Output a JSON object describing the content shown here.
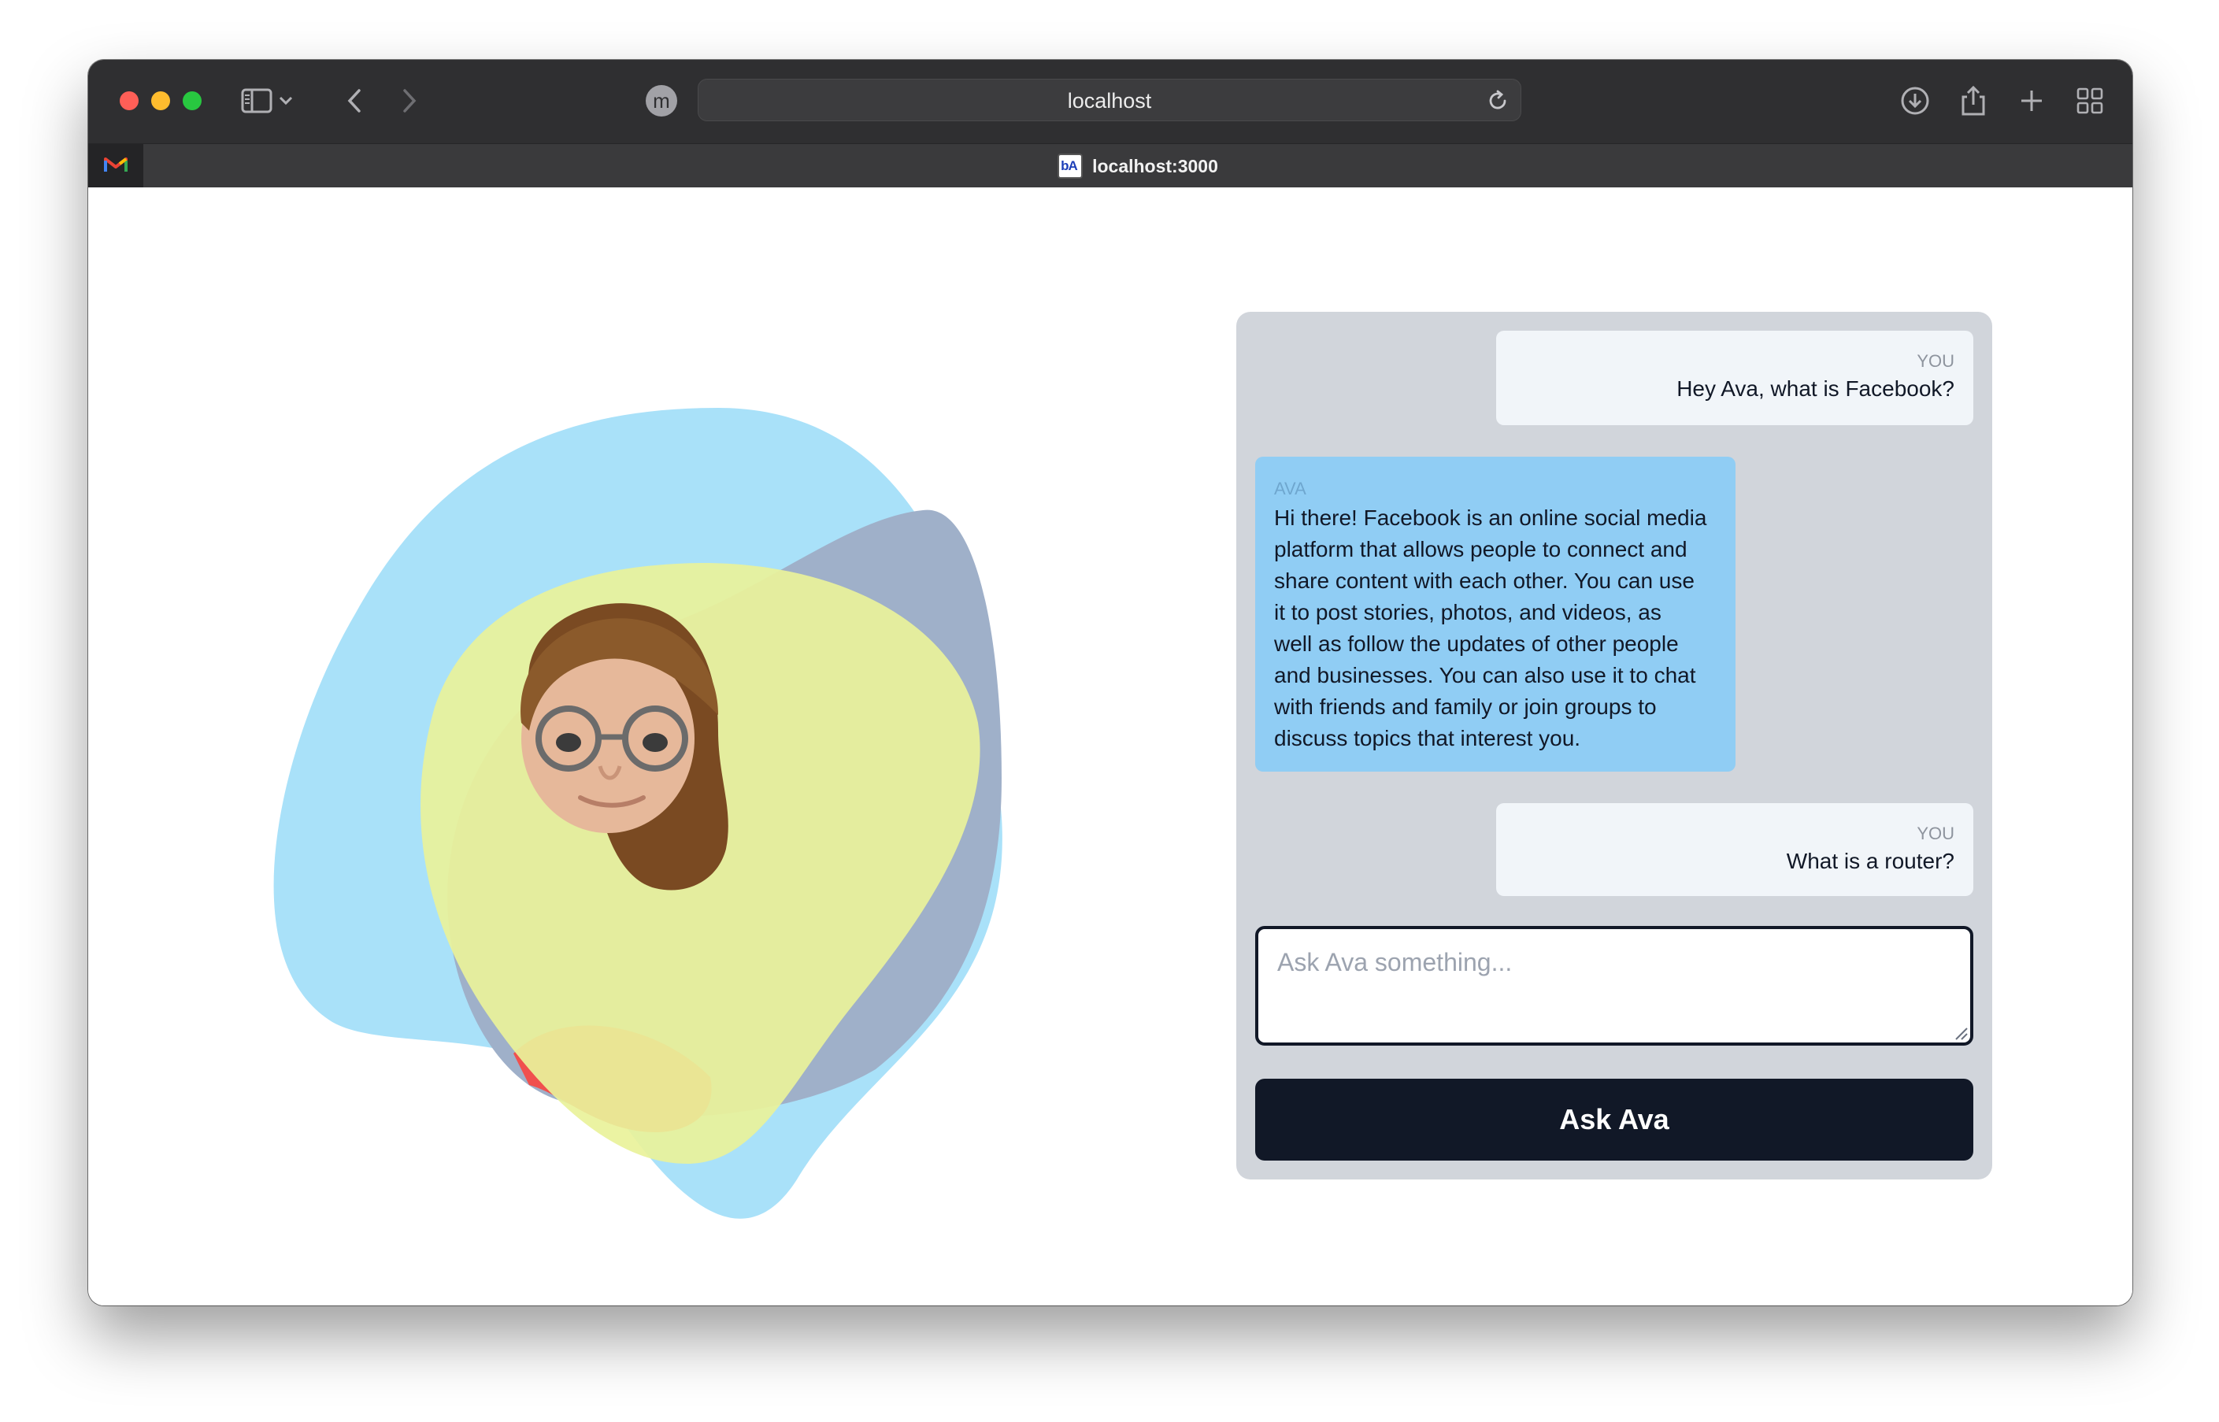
{
  "browser": {
    "url": "localhost",
    "profile_initial": "m",
    "tab_title": "localhost:3000",
    "favicon_text": "bA"
  },
  "icons": {
    "sidebar_toggle": "sidebar-icon",
    "back": "chevron-left-icon",
    "forward": "chevron-right-icon",
    "reload": "reload-icon",
    "downloads": "download-icon",
    "share": "share-icon",
    "new_tab": "plus-icon",
    "tab_overview": "grid-icon",
    "pinned_tab": "gmail-icon"
  },
  "colors": {
    "blob_blue": "#a9e1f9",
    "blob_slate": "#9fb0c9",
    "blob_yellow": "#e9f29a",
    "blob_red": "#f0504e",
    "user_bubble": "#f1f5f9",
    "ava_bubble": "#90cdf4",
    "panel": "#d1d5db",
    "button": "#111827"
  },
  "chat": {
    "messages": [
      {
        "sender": "YOU",
        "text": "Hey Ava, what is Facebook?"
      },
      {
        "sender": "AVA",
        "lines": [
          "Hi there! Facebook is an online social media",
          "platform that allows people to connect and",
          "share content with each other. You can use",
          "it to post stories, photos, and videos, as",
          "well as follow the updates of other people",
          "and businesses. You can also use it to chat",
          "with friends and family or join groups to",
          "discuss topics that interest you."
        ]
      },
      {
        "sender": "YOU",
        "text": "What is a router?"
      }
    ],
    "input_placeholder": "Ask Ava something...",
    "input_value": "",
    "button_label": "Ask Ava"
  }
}
